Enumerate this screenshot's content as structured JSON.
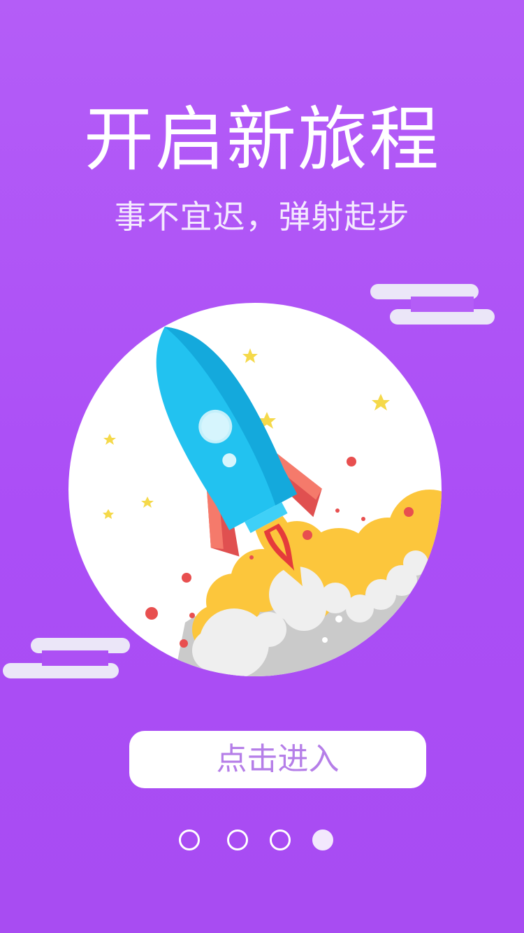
{
  "intro": {
    "title": "开启新旅程",
    "subtitle": "事不宜迟，弹射起步"
  },
  "illustration": {
    "icon": "rocket-launch-illustration"
  },
  "enter_button": {
    "label": "点击进入"
  },
  "pagination": {
    "total": 4,
    "active_index": 3
  },
  "colors": {
    "background_top": "#b45df7",
    "background_bottom": "#a84cf2",
    "button_text": "#b57ee8",
    "rocket_body": "#22c2f0",
    "rocket_fin": "#e05050",
    "flame": "#fcc63c",
    "star": "#f5d94a",
    "cloud": "#ebe6f8"
  }
}
